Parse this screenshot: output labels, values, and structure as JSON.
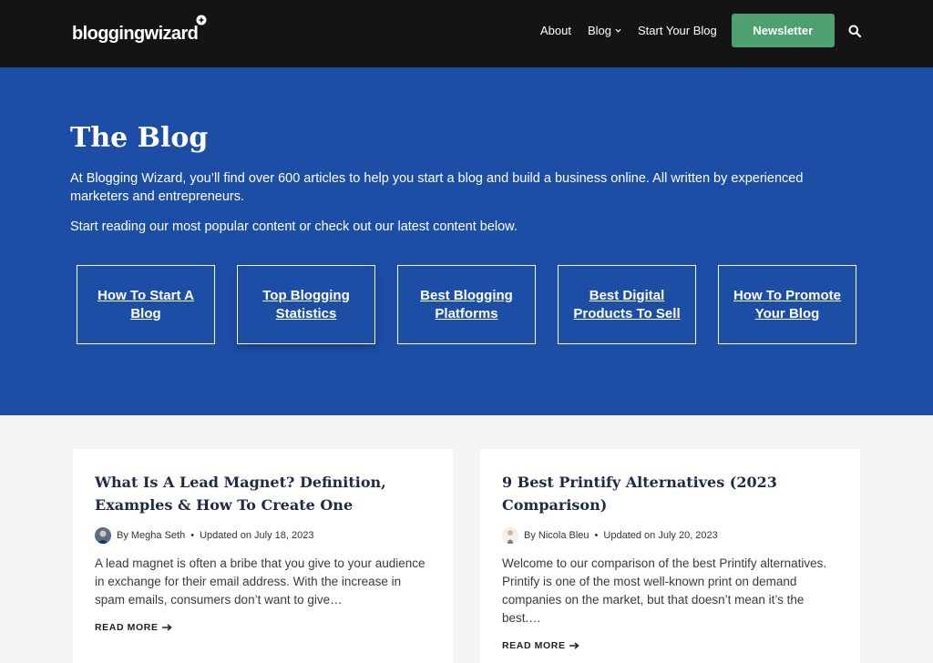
{
  "header": {
    "logo": "bloggingwizard",
    "nav": {
      "about": "About",
      "blog": "Blog",
      "start": "Start Your Blog"
    },
    "newsletter": "Newsletter"
  },
  "hero": {
    "title": "The Blog",
    "intro": "At Blogging Wizard, you’ll find over 600 articles to help you start a blog and build a business online. All written by experienced marketers and entrepreneurs.",
    "sub": "Start reading our most popular content or check out our latest content below.",
    "cards": [
      "How To Start A Blog",
      "Top Blogging Statistics",
      "Best Blogging Platforms",
      "Best Digital Products To Sell",
      "How To Promote Your Blog"
    ]
  },
  "posts": [
    {
      "title": "What Is A Lead Magnet? Definition, Examples & How To Create One",
      "author": "By Megha Seth",
      "date": "Updated on July 18, 2023",
      "excerpt": "A lead magnet is often a bribe that you give to your audience in exchange for their email address.  With the increase in spam emails, consumers don’t want to give…",
      "readmore": "READ MORE"
    },
    {
      "title": "9 Best Printify Alternatives (2023 Comparison)",
      "author": "By Nicola Bleu",
      "date": "Updated on July 20, 2023",
      "excerpt": "Welcome to our comparison of the best Printify alternatives. Printify is one of the most well-known print on demand companies on the market, but that doesn’t mean it’s the best.…",
      "readmore": "READ MORE"
    }
  ],
  "colors": {
    "header_bg": "#141414",
    "hero_bg": "#1d4ea6",
    "accent_green": "#4ea070",
    "page_bg": "#f3f4f6"
  }
}
